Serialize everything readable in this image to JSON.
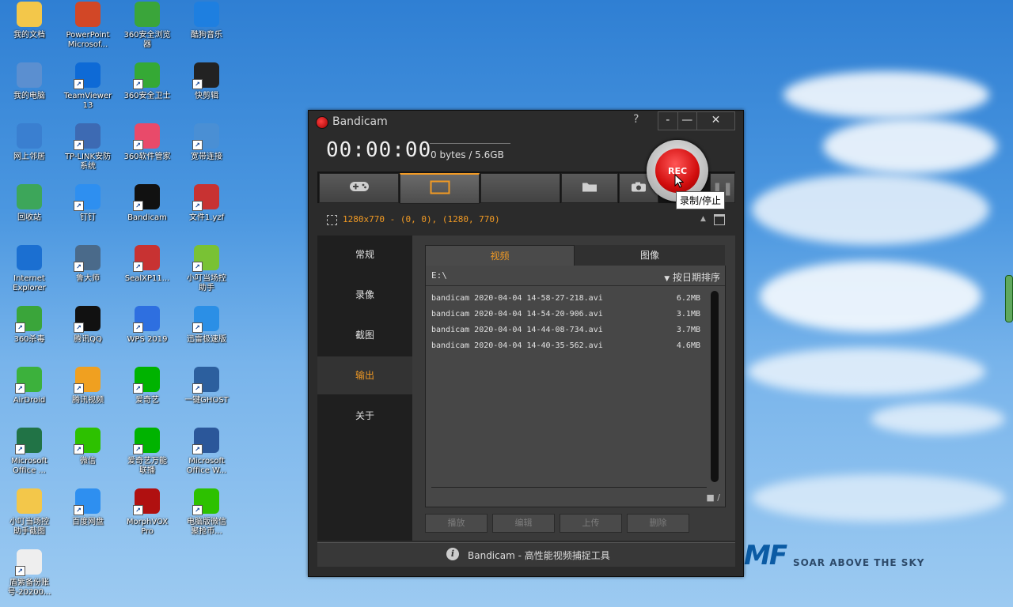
{
  "desktop": {
    "icons": [
      {
        "label": "我的文档",
        "icon": "my-documents-icon",
        "color": "#f3c74a"
      },
      {
        "label": "PowerPoint\nMicrosof...",
        "icon": "powerpoint-icon",
        "color": "#d24726"
      },
      {
        "label": "360安全浏览\n器",
        "icon": "360-browser-icon",
        "color": "#3aa53a"
      },
      {
        "label": "酷狗音乐",
        "icon": "kugou-music-icon",
        "color": "#1e7fe0"
      },
      {
        "label": "我的电脑",
        "icon": "my-computer-icon",
        "color": "#5b8fd0"
      },
      {
        "label": "TeamViewer\n13",
        "icon": "teamviewer-icon",
        "color": "#0e6ad6"
      },
      {
        "label": "360安全卫士",
        "icon": "360-safeguard-icon",
        "color": "#35a935"
      },
      {
        "label": "快剪辑",
        "icon": "kuaijianji-icon",
        "color": "#222222"
      },
      {
        "label": "网上邻居",
        "icon": "network-icon",
        "color": "#3a7fd0"
      },
      {
        "label": "TP-LINK安防\n系统",
        "icon": "tp-link-icon",
        "color": "#3d6ab3"
      },
      {
        "label": "360软件管家",
        "icon": "360-software-icon",
        "color": "#e94a6a"
      },
      {
        "label": "宽带连接",
        "icon": "broadband-icon",
        "color": "#4a8fd4"
      },
      {
        "label": "回收站",
        "icon": "recycle-bin-icon",
        "color": "#3da65a"
      },
      {
        "label": "钉钉",
        "icon": "dingtalk-icon",
        "color": "#2e8ff0"
      },
      {
        "label": "Bandicam",
        "icon": "bandicam-icon",
        "color": "#111111"
      },
      {
        "label": "文件1.yzf",
        "icon": "yzf-file-icon",
        "color": "#c83232"
      },
      {
        "label": "Internet\nExplorer",
        "icon": "ie-icon",
        "color": "#1b6fd1"
      },
      {
        "label": "鲁大师",
        "icon": "ludashi-icon",
        "color": "#4a6a8a"
      },
      {
        "label": "SealXP11...",
        "icon": "seal-icon",
        "color": "#c83232"
      },
      {
        "label": "小叮当场控\n助手",
        "icon": "xiaodingdang-icon",
        "color": "#79c234"
      },
      {
        "label": "360杀毒",
        "icon": "360-antivirus-icon",
        "color": "#3aa53a"
      },
      {
        "label": "腾讯QQ",
        "icon": "qq-icon",
        "color": "#111111"
      },
      {
        "label": "WPS 2019",
        "icon": "wps-icon",
        "color": "#2e6fe0"
      },
      {
        "label": "迅雷极速版",
        "icon": "xunlei-icon",
        "color": "#2b8fe6"
      },
      {
        "label": "AirDroid",
        "icon": "airdroid-icon",
        "color": "#3cb13c"
      },
      {
        "label": "腾讯视频",
        "icon": "tencent-video-icon",
        "color": "#f0a020"
      },
      {
        "label": "爱奇艺",
        "icon": "iqiyi-icon",
        "color": "#00b300"
      },
      {
        "label": "一键GHOST",
        "icon": "ghost-icon",
        "color": "#2c5f9e"
      },
      {
        "label": "Microsoft\nOffice ...",
        "icon": "excel-icon",
        "color": "#217346"
      },
      {
        "label": "微信",
        "icon": "wechat-icon",
        "color": "#2dc100"
      },
      {
        "label": "爱奇艺万能\n联播",
        "icon": "iqiyi-wanneng-icon",
        "color": "#00b300"
      },
      {
        "label": "Microsoft\nOffice W...",
        "icon": "word-icon",
        "color": "#2b579a"
      },
      {
        "label": "小叮当场控\n助手截图",
        "icon": "folder-icon",
        "color": "#f3c74a"
      },
      {
        "label": "百度网盘",
        "icon": "baidu-netdisk-icon",
        "color": "#2e8ff0"
      },
      {
        "label": "MorphVOX\nPro",
        "icon": "morphvox-icon",
        "color": "#b01010"
      },
      {
        "label": "电脑版微信\n聚抢币...",
        "icon": "wechat-tool-icon",
        "color": "#2dc100"
      },
      {
        "label": "盾紫备份账\n号-20200...",
        "icon": "text-file-icon",
        "color": "#eeeeee"
      }
    ]
  },
  "window": {
    "title": "Bandicam",
    "help": "?",
    "minimize_small": "-",
    "minimize": "—",
    "close": "✕",
    "timer": "00:00:00",
    "size": "0 bytes / 5.6GB",
    "rec_label": "REC",
    "tooltip": "录制/停止",
    "region": "1280x770 - (0, 0), (1280, 770)",
    "sidebar": [
      "常规",
      "录像",
      "截图",
      "输出",
      "关于"
    ],
    "active_sidebar": "输出",
    "output_tabs": [
      "视频",
      "图像"
    ],
    "path": "E:\\",
    "sort": "按日期排序",
    "files": [
      {
        "name": "bandicam 2020-04-04 14-58-27-218.avi",
        "size": "6.2MB"
      },
      {
        "name": "bandicam 2020-04-04 14-54-20-906.avi",
        "size": "3.1MB"
      },
      {
        "name": "bandicam 2020-04-04 14-44-08-734.avi",
        "size": "3.7MB"
      },
      {
        "name": "bandicam 2020-04-04 14-40-35-562.avi",
        "size": "4.6MB"
      }
    ],
    "folder_path": "/",
    "actions": [
      "播放",
      "编辑",
      "上传",
      "删除"
    ],
    "footer": "Bandicam - 高性能视频捕捉工具",
    "accent": "#f19a24"
  },
  "watermark": {
    "logo": "MF",
    "tagline": "SOAR ABOVE THE SKY"
  }
}
